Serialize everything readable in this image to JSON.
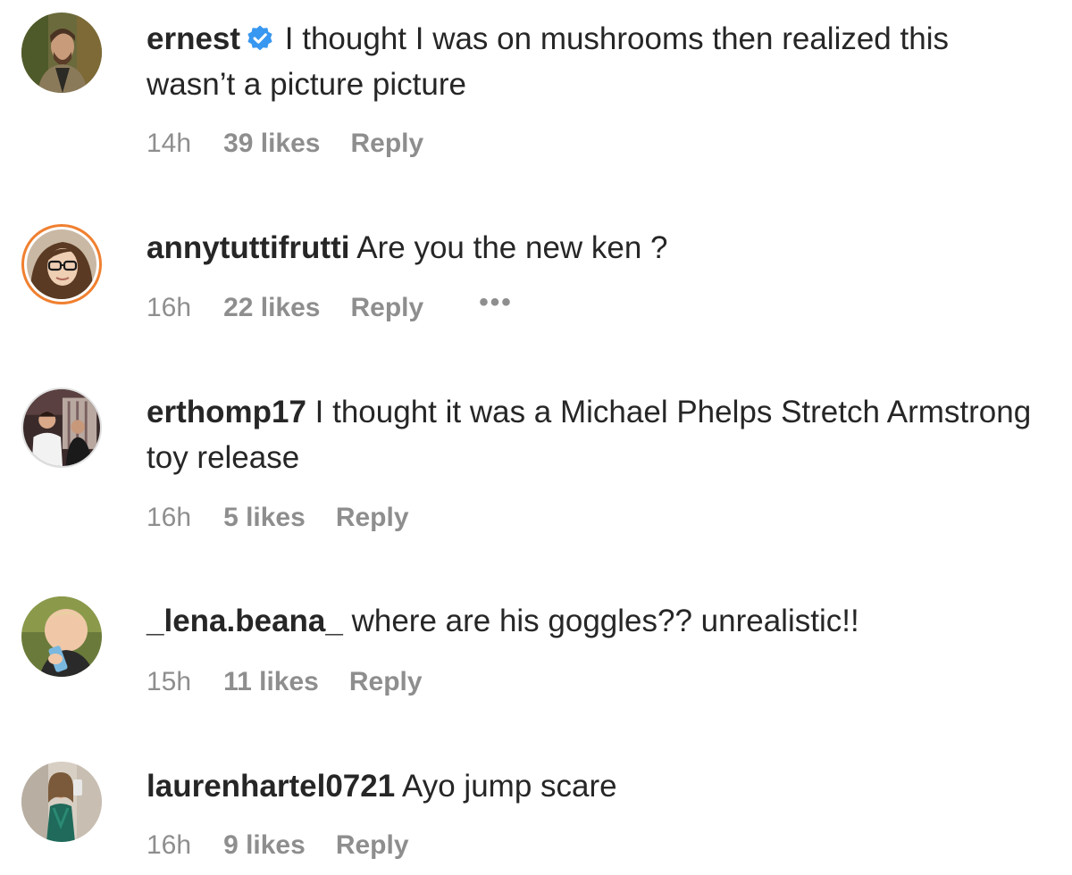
{
  "comments": [
    {
      "username": "ernest",
      "verified": true,
      "text": "I thought I was on mushrooms then realized this wasn’t a picture picture",
      "time": "14h",
      "likes": "39 likes",
      "reply": "Reply"
    },
    {
      "username": "annytuttifrutti",
      "verified": false,
      "text": "Are you the new ken ?",
      "time": "16h",
      "likes": "22 likes",
      "reply": "Reply",
      "more": "•••"
    },
    {
      "username": "erthomp17",
      "verified": false,
      "text": "I thought it was a Michael Phelps Stretch Armstrong toy release",
      "time": "16h",
      "likes": "5 likes",
      "reply": "Reply"
    },
    {
      "username": "_lena.beana_",
      "verified": false,
      "text": "where are his goggles?? unrealistic!!",
      "time": "15h",
      "likes": "11 likes",
      "reply": "Reply"
    },
    {
      "username": "laurenhartel0721",
      "verified": false,
      "text": "Ayo jump scare",
      "time": "16h",
      "likes": "9 likes",
      "reply": "Reply"
    }
  ],
  "icons": {
    "verified_badge": "verified-badge-icon",
    "more_options": "more-options-icon"
  },
  "colors": {
    "verified_blue": "#3897f0",
    "meta_gray": "#8e8e8e",
    "story_ring": "#f08030"
  }
}
